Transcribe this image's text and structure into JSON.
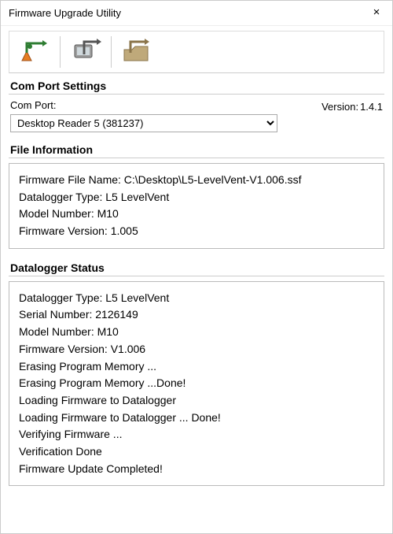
{
  "window": {
    "title": "Firmware Upgrade Utility",
    "close": "×"
  },
  "toolbar": {
    "open_icon": "open-file-icon",
    "upload_icon": "upload-device-icon",
    "folder_icon": "browse-folder-icon"
  },
  "comport": {
    "group_title": "Com Port Settings",
    "label": "Com Port:",
    "selected": "Desktop Reader 5 (381237)"
  },
  "version": {
    "label": "Version:",
    "value": "1.4.1"
  },
  "file_info": {
    "group_title": "File Information",
    "lines": {
      "l0": "Firmware File Name: C:\\Desktop\\L5-LevelVent-V1.006.ssf",
      "l1": "Datalogger Type: L5 LevelVent",
      "l2": "Model Number: M10",
      "l3": "Firmware Version: 1.005"
    }
  },
  "status": {
    "group_title": "Datalogger Status",
    "lines": {
      "l0": "Datalogger Type: L5 LevelVent",
      "l1": "Serial Number: 2126149",
      "l2": "Model Number: M10",
      "l3": "Firmware Version: V1.006",
      "l4": "Erasing Program Memory ...",
      "l5": "Erasing Program Memory ...Done!",
      "l6": "Loading Firmware to Datalogger",
      "l7": "Loading Firmware to Datalogger ... Done!",
      "l8": "Verifying Firmware ...",
      "l9": "Verification Done",
      "l10": "Firmware Update Completed!"
    }
  }
}
